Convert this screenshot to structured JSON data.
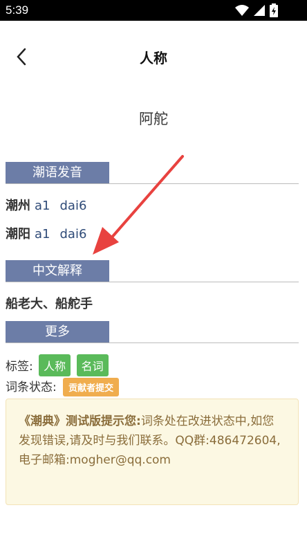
{
  "status_bar": {
    "time": "5:39",
    "icons": [
      "wifi-icon",
      "signal-icon",
      "battery-icon"
    ]
  },
  "header": {
    "title": "人称",
    "back_icon": "chevron-left-icon"
  },
  "entry": {
    "word": "阿舵"
  },
  "sections": {
    "pronunciation_title": "潮语发音",
    "meaning_title": "中文解释",
    "more_title": "更多"
  },
  "pronunciations": [
    {
      "place": "潮州",
      "syl1": "a1",
      "syl2": "dai6"
    },
    {
      "place": "潮阳",
      "syl1": "a1",
      "syl2": "dai6"
    }
  ],
  "meaning": "船老大、船舵手",
  "more": {
    "tags_label": "标签:",
    "tags": [
      "人称",
      "名词"
    ],
    "status_label": "词条状态:",
    "status_badge": "贡献者提交"
  },
  "notice": {
    "bold_prefix": "《潮典》测试版提示您:",
    "text": "词条处在改进状态中,如您发现错误,请及时与我们联系。QQ群:486472604,电子邮箱:mogher@qq.com"
  },
  "colors": {
    "section_bg": "#6c7da7",
    "tag_green": "#5aba5a",
    "badge_orange": "#f0ad4e",
    "notice_bg": "#fcf8e3",
    "arrow": "#e8423f"
  }
}
